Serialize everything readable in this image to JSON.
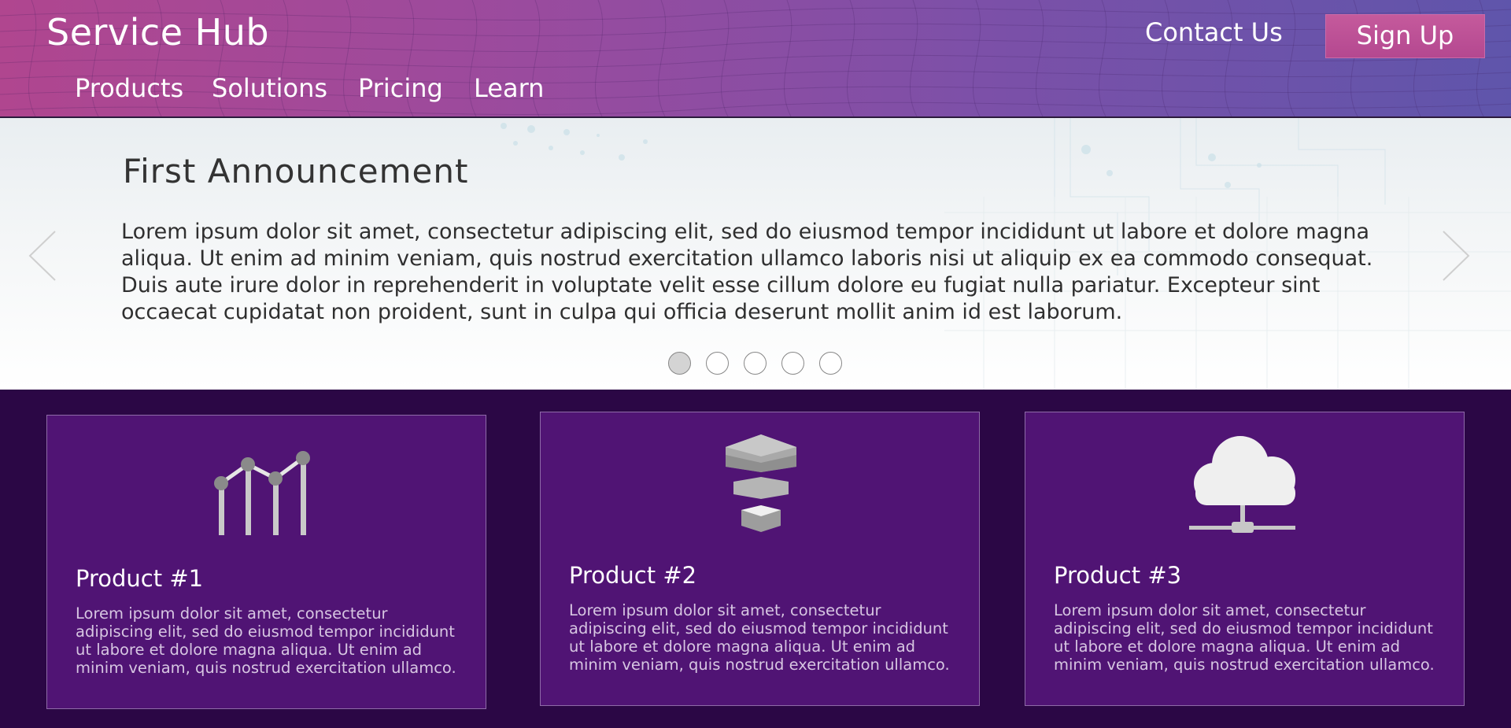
{
  "header": {
    "brand": "Service Hub",
    "nav": [
      "Products",
      "Solutions",
      "Pricing",
      "Learn"
    ],
    "contact_label": "Contact Us",
    "signup_label": "Sign Up"
  },
  "hero": {
    "title": "First Announcement",
    "body": "Lorem ipsum dolor sit amet, consectetur adipiscing elit, sed do eiusmod tempor incididunt ut labore et dolore magna aliqua. Ut enim ad minim veniam, quis nostrud exercitation ullamco laboris nisi ut aliquip ex ea commodo consequat. Duis aute irure dolor in reprehenderit in voluptate velit esse cillum dolore eu fugiat nulla pariatur. Excepteur sint occaecat cupidatat non proident, sunt in culpa qui officia deserunt mollit anim id est laborum.",
    "slide_count": 5,
    "active_slide": 1,
    "prev_icon": "chevron-left-icon",
    "next_icon": "chevron-right-icon"
  },
  "products": [
    {
      "title": "Product #1",
      "description": "Lorem ipsum dolor sit amet, consectetur adipiscing elit, sed do eiusmod tempor incididunt ut labore et dolore magna aliqua. Ut enim ad minim veniam, quis nostrud exercitation ullamco.",
      "icon": "line-chart-icon"
    },
    {
      "title": "Product #2",
      "description": "Lorem ipsum dolor sit amet, consectetur adipiscing elit, sed do eiusmod tempor incididunt ut labore et dolore magna aliqua. Ut enim ad minim veniam, quis nostrud exercitation ullamco.",
      "icon": "layers-icon"
    },
    {
      "title": "Product #3",
      "description": "Lorem ipsum dolor sit amet, consectetur adipiscing elit, sed do eiusmod tempor incididunt ut labore et dolore magna aliqua. Ut enim ad minim veniam, quis nostrud exercitation ullamco.",
      "icon": "cloud-network-icon"
    }
  ],
  "colors": {
    "header_start": "#b0468f",
    "header_end": "#5f55ab",
    "signup_bg": "#c55a9c",
    "products_bg": "#2b0745",
    "card_bg": "#501474"
  }
}
